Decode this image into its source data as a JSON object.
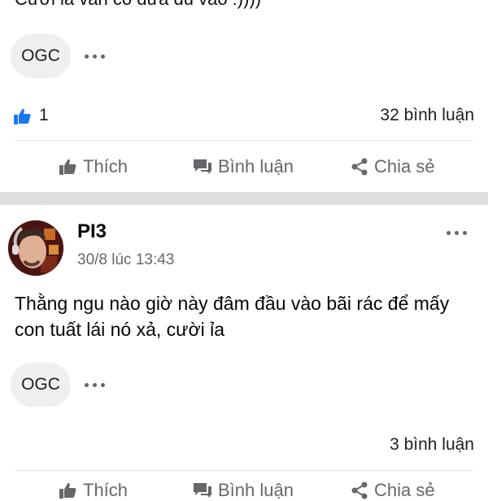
{
  "post1": {
    "text_tail": "Cười ỉa vẫn cố đưa đủ vào :))))",
    "tag": "OGC",
    "like_count": "1",
    "comment_count": "32 bình luận"
  },
  "actions": {
    "like": "Thích",
    "comment": "Bình luận",
    "share": "Chia sẻ"
  },
  "post2": {
    "author": "PI3",
    "timestamp": "30/8 lúc 13:43",
    "text": "Thằng ngu nào giờ này đâm đầu vào bãi rác để mấy con tuất lái nó xả, cười ỉa",
    "tag": "OGC",
    "comment_count": "3 bình luận"
  },
  "colors": {
    "like_blue": "#1877f2",
    "secondary_text": "#65676b",
    "pill_bg": "#eeeff1",
    "separator_band": "#dcdee2"
  },
  "icons": [
    "thumbs-up-icon",
    "comment-icon",
    "share-icon",
    "more-dots-icon"
  ]
}
